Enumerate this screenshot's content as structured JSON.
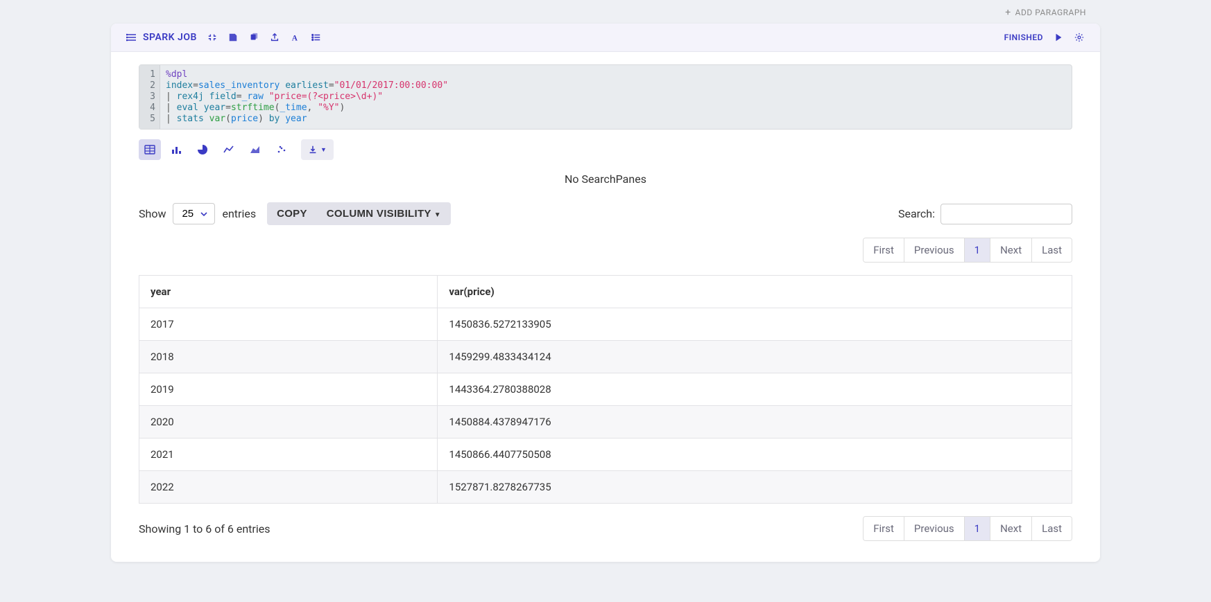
{
  "add_paragraph": {
    "label": "ADD PARAGRAPH"
  },
  "header": {
    "title": "SPARK JOB",
    "status": "FINISHED"
  },
  "icons": {
    "list": "list-icon",
    "minimize": "minimize-icon",
    "save": "save-icon",
    "copy": "copy-icon",
    "export": "export-icon",
    "font": "font-icon",
    "bullets": "numbered-list-icon",
    "play": "play-icon",
    "gear": "gear-icon",
    "table": "table-icon",
    "bar": "bar-chart-icon",
    "pie": "pie-chart-icon",
    "line": "line-chart-icon",
    "area": "area-chart-icon",
    "scatter": "scatter-chart-icon",
    "download": "download-icon"
  },
  "code": {
    "line_numbers": [
      "1",
      "2",
      "3",
      "4",
      "5"
    ],
    "lines": {
      "l1_a": "%dpl",
      "l2_a": "index",
      "l2_b": "=",
      "l2_c": "sales_inventory",
      "l2_d": " earliest",
      "l2_e": "=",
      "l2_f": "\"01/01/2017:00:00:00\"",
      "l3_a": "| ",
      "l3_b": "rex4j",
      "l3_c": " field",
      "l3_d": "=",
      "l3_e": "_raw",
      "l3_f": " \"price=(?<price>\\d+)\"",
      "l4_a": "| ",
      "l4_b": "eval",
      "l4_c": " year",
      "l4_d": "=",
      "l4_e": "strftime",
      "l4_f": "(",
      "l4_g": "_time",
      "l4_h": ", ",
      "l4_i": "\"%Y\"",
      "l4_j": ")",
      "l5_a": "| ",
      "l5_b": "stats",
      "l5_c": " var",
      "l5_d": "(",
      "l5_e": "price",
      "l5_f": ") ",
      "l5_g": "by",
      "l5_h": " year"
    }
  },
  "search_panes": "No SearchPanes",
  "controls": {
    "show": "Show",
    "entries": "entries",
    "select_value": "25",
    "copy": "COPY",
    "column_visibility": "COLUMN VISIBILITY",
    "search_label": "Search:"
  },
  "pagination": {
    "first": "First",
    "previous": "Previous",
    "page": "1",
    "next": "Next",
    "last": "Last"
  },
  "table": {
    "headers": [
      "year",
      "var(price)"
    ],
    "rows": [
      [
        "2017",
        "1450836.5272133905"
      ],
      [
        "2018",
        "1459299.4833434124"
      ],
      [
        "2019",
        "1443364.2780388028"
      ],
      [
        "2020",
        "1450884.4378947176"
      ],
      [
        "2021",
        "1450866.4407750508"
      ],
      [
        "2022",
        "1527871.8278267735"
      ]
    ]
  },
  "info": "Showing 1 to 6 of 6 entries"
}
